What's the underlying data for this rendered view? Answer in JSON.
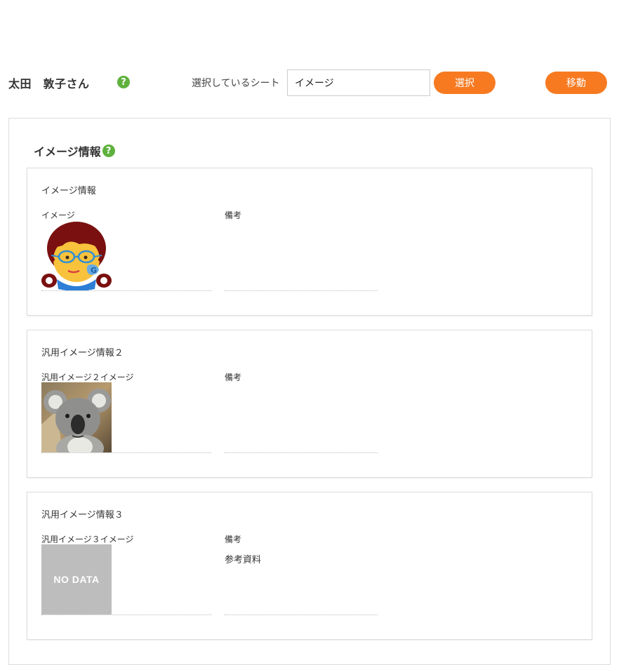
{
  "header": {
    "user_name": "太田　敦子さん",
    "help_symbol": "?",
    "sheet_label": "選択しているシート",
    "sheet_value": "イメージ",
    "select_button": "選択",
    "move_button": "移動"
  },
  "colors": {
    "accent": "#f77a21",
    "help": "#5fb13d"
  },
  "section": {
    "title": "イメージ情報"
  },
  "cards": [
    {
      "title": "イメージ情報",
      "image_label": "イメージ",
      "note_label": "備考",
      "image": "avatar-illustration",
      "note": ""
    },
    {
      "title": "汎用イメージ情報２",
      "image_label": "汎用イメージ２イメージ",
      "note_label": "備考",
      "image": "koala-photo",
      "note": ""
    },
    {
      "title": "汎用イメージ情報３",
      "image_label": "汎用イメージ３イメージ",
      "note_label": "備考",
      "image": "no-data",
      "nodata_text": "NO DATA",
      "note": "参考資料"
    }
  ]
}
